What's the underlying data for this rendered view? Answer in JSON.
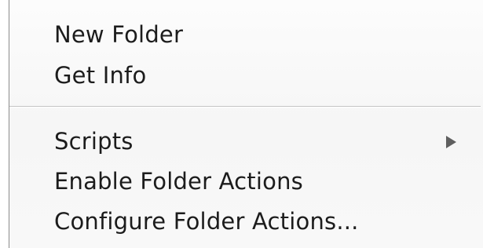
{
  "context_menu": {
    "items": [
      {
        "label": "New Folder"
      },
      {
        "label": "Get Info"
      },
      {
        "label": "Scripts",
        "submenu": true,
        "icon": "submenu-arrow-icon"
      },
      {
        "label": "Enable Folder Actions"
      },
      {
        "label": "Configure Folder Actions..."
      }
    ]
  },
  "colors": {
    "text": "#1c1c1c",
    "separator": "#c3c3c3",
    "arrow": "#5f5f5f",
    "border": "#8c8c8c"
  }
}
